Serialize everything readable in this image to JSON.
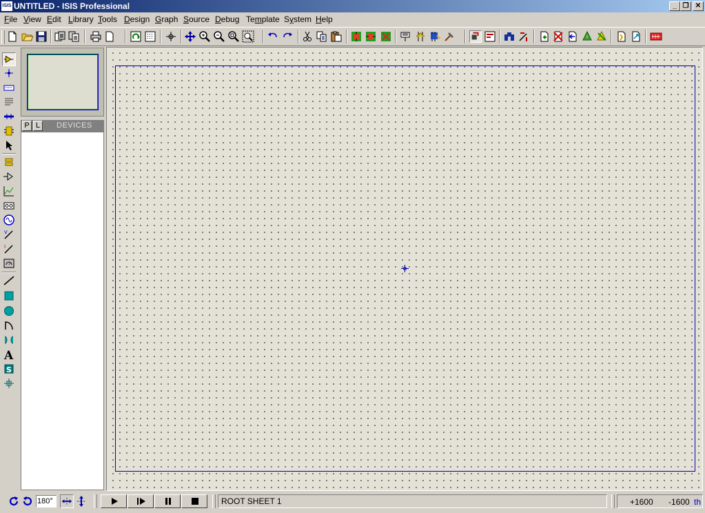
{
  "window": {
    "app_icon_text": "ISIS",
    "title": "UNTITLED - ISIS Professional",
    "minimize": "_",
    "restore": "❐",
    "close": "✕"
  },
  "menu": [
    {
      "label": "File",
      "mnemonic": "F",
      "rest": "ile"
    },
    {
      "label": "View",
      "mnemonic": "V",
      "rest": "iew"
    },
    {
      "label": "Edit",
      "mnemonic": "E",
      "rest": "dit"
    },
    {
      "label": "Library",
      "mnemonic": "L",
      "rest": "ibrary"
    },
    {
      "label": "Tools",
      "mnemonic": "T",
      "rest": "ools"
    },
    {
      "label": "Design",
      "mnemonic": "D",
      "rest": "esign"
    },
    {
      "label": "Graph",
      "mnemonic": "G",
      "rest": "raph"
    },
    {
      "label": "Source",
      "mnemonic": "S",
      "rest": "ource"
    },
    {
      "label": "Debug",
      "mnemonic": "D",
      "rest": "ebug"
    },
    {
      "label": "Template",
      "mnemonic": "m",
      "pre": "Te",
      "rest": "plate"
    },
    {
      "label": "System",
      "mnemonic": "y",
      "pre": "S",
      "rest": "stem"
    },
    {
      "label": "Help",
      "mnemonic": "H",
      "rest": "elp"
    }
  ],
  "devices_panel": {
    "pick_button": "P",
    "library_button": "L",
    "title": "DEVICES"
  },
  "status": {
    "rotation": "180°",
    "sheet": "ROOT SHEET 1",
    "x": "+1600",
    "y": "-1600",
    "units": "th"
  },
  "colors": {
    "sheet_border": "#0000b0",
    "canvas_bg": "#e4e2d6",
    "title_start": "#0a246a"
  }
}
